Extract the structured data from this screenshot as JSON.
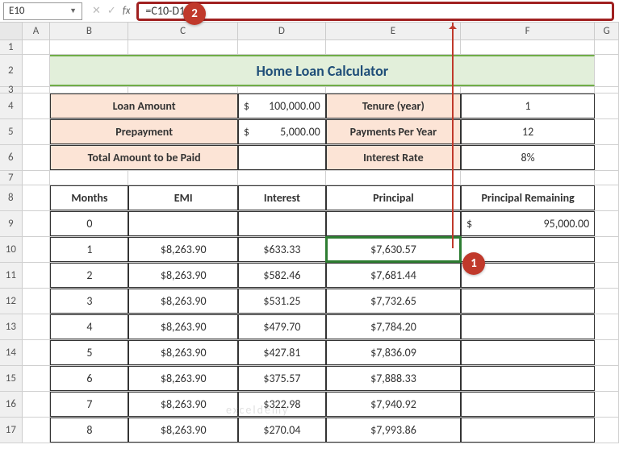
{
  "namebox": "E10",
  "formula": "=C10-D10",
  "columns": [
    "A",
    "B",
    "C",
    "D",
    "E",
    "F",
    "G"
  ],
  "title": "Home Loan Calculator",
  "params": {
    "loanAmountLabel": "Loan Amount",
    "loanAmountCur": "$",
    "loanAmountVal": "100,000.00",
    "tenureLabel": "Tenure (year)",
    "tenureVal": "1",
    "prepayLabel": "Prepayment",
    "prepayCur": "$",
    "prepayVal": "5,000.00",
    "ppyLabel": "Payments Per Year",
    "ppyVal": "12",
    "totalLabel": "Total Amount to be Paid",
    "rateLabel": "Interest Rate",
    "rateVal": "8%"
  },
  "tableHeaders": [
    "Months",
    "EMI",
    "Interest",
    "Principal",
    "Principal Remaining"
  ],
  "row9": {
    "months": "0",
    "remainCur": "$",
    "remainVal": "95,000.00"
  },
  "rows": [
    {
      "r": "10",
      "m": "1",
      "emi": "$8,263.90",
      "int": "$633.33",
      "prin": "$7,630.57"
    },
    {
      "r": "11",
      "m": "2",
      "emi": "$8,263.90",
      "int": "$582.46",
      "prin": "$7,681.44"
    },
    {
      "r": "12",
      "m": "3",
      "emi": "$8,263.90",
      "int": "$531.25",
      "prin": "$7,732.65"
    },
    {
      "r": "13",
      "m": "4",
      "emi": "$8,263.90",
      "int": "$479.70",
      "prin": "$7,784.20"
    },
    {
      "r": "14",
      "m": "5",
      "emi": "$8,263.90",
      "int": "$427.81",
      "prin": "$7,836.09"
    },
    {
      "r": "15",
      "m": "6",
      "emi": "$8,263.90",
      "int": "$375.57",
      "prin": "$7,888.33"
    },
    {
      "r": "16",
      "m": "7",
      "emi": "$8,263.90",
      "int": "$322.98",
      "prin": "$7,940.92"
    },
    {
      "r": "17",
      "m": "8",
      "emi": "$8,263.90",
      "int": "$270.04",
      "prin": "$7,993.86"
    }
  ],
  "callouts": {
    "c1": "1",
    "c2": "2"
  },
  "watermark": "exceldemy"
}
